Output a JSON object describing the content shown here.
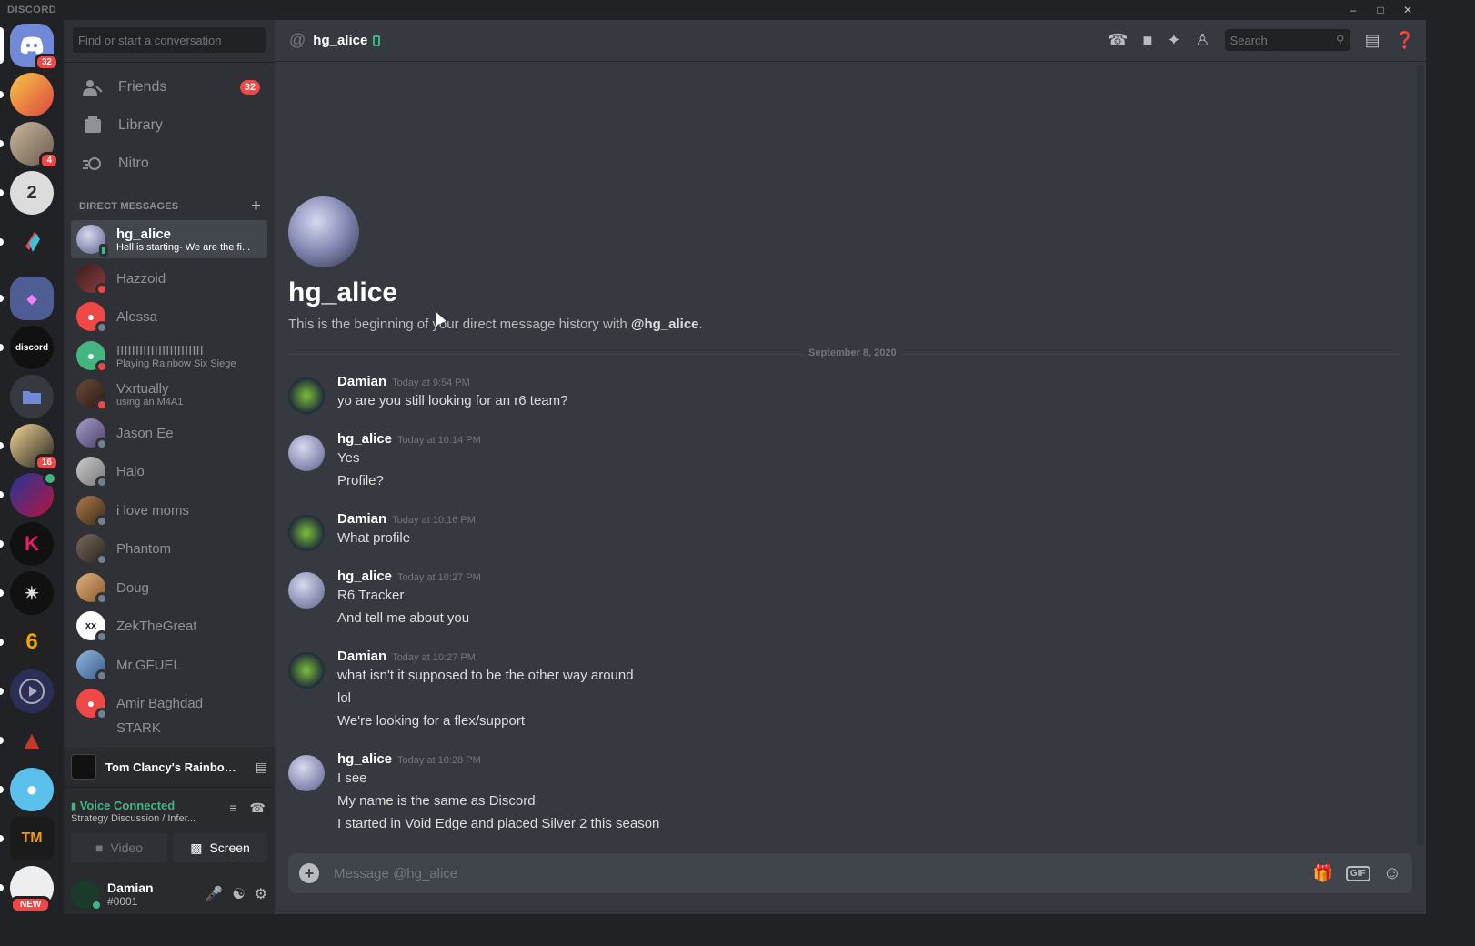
{
  "window": {
    "brand": "DISCORD",
    "controls": [
      "minimize-icon",
      "maximize-icon",
      "close-icon"
    ]
  },
  "guilds": {
    "home_badge": "32",
    "badges": {
      "g2": "4",
      "g9": "16"
    },
    "labels": {
      "g7": "discord",
      "g17": "NEW"
    }
  },
  "sidebar": {
    "search_placeholder": "Find or start a conversation",
    "nav": [
      {
        "label": "Friends",
        "badge": "32"
      },
      {
        "label": "Library"
      },
      {
        "label": "Nitro"
      }
    ],
    "dm_header": "DIRECT MESSAGES",
    "dms": [
      {
        "name": "hg_alice",
        "sub": "Hell is starting- We are the fi...",
        "status": "mobile"
      },
      {
        "name": "Hazzoid",
        "sub": "",
        "status": "dnd"
      },
      {
        "name": "Alessa",
        "sub": "",
        "status": "offline"
      },
      {
        "name": "IIIIIIIIIIIIIIIIIIIIIII",
        "sub": "Playing Rainbow Six Siege",
        "status": "dnd"
      },
      {
        "name": "Vxrtually",
        "sub": "using an M4A1",
        "status": "dnd"
      },
      {
        "name": "Jason Ee",
        "sub": "",
        "status": "offline"
      },
      {
        "name": "Halo",
        "sub": "",
        "status": "offline"
      },
      {
        "name": "i love moms",
        "sub": "",
        "status": "offline"
      },
      {
        "name": "Phantom",
        "sub": "",
        "status": "offline"
      },
      {
        "name": "Doug",
        "sub": "",
        "status": "offline"
      },
      {
        "name": "ZekTheGreat",
        "sub": "",
        "status": "offline"
      },
      {
        "name": "Mr.GFUEL",
        "sub": "",
        "status": "offline"
      },
      {
        "name": "Amir Baghdad",
        "sub": "",
        "status": "offline"
      },
      {
        "name": "STARK",
        "sub": "",
        "status": "dnd"
      }
    ],
    "game": "Tom Clancy's Rainbow ...",
    "voice": {
      "status": "Voice Connected",
      "channel": "Strategy Discussion / Infer...",
      "video_label": "Video",
      "screen_label": "Screen"
    },
    "user": {
      "name": "Damian",
      "tag": "#0001"
    }
  },
  "channel": {
    "title": "hg_alice",
    "search_placeholder": "Search",
    "intro_title": "hg_alice",
    "intro_text": "This is the beginning of your direct message history with ",
    "intro_mention": "@hg_alice",
    "intro_end": ".",
    "date_divider": "September 8, 2020"
  },
  "messages": [
    {
      "author": "Damian",
      "time": "Today at 9:54 PM",
      "lines": [
        "yo are you still looking for an r6 team?"
      ]
    },
    {
      "author": "hg_alice",
      "time": "Today at 10:14 PM",
      "lines": [
        "Yes",
        "Profile?"
      ]
    },
    {
      "author": "Damian",
      "time": "Today at 10:16 PM",
      "lines": [
        "What profile"
      ]
    },
    {
      "author": "hg_alice",
      "time": "Today at 10:27 PM",
      "lines": [
        "R6 Tracker",
        "And tell me about you"
      ]
    },
    {
      "author": "Damian",
      "time": "Today at 10:27 PM",
      "lines": [
        "what isn't it supposed to be the other way around",
        "lol",
        "We're looking for a flex/support"
      ]
    },
    {
      "author": "hg_alice",
      "time": "Today at 10:28 PM",
      "lines": [
        "I see",
        "My name is the same as Discord",
        "I started in Void Edge and placed Silver 2 this season"
      ]
    }
  ],
  "composer": {
    "placeholder": "Message @hg_alice",
    "gif_label": "GIF"
  },
  "colors": {
    "accent": "#7289da",
    "online": "#43b581",
    "dnd": "#f04747",
    "offline": "#747f8d",
    "badge": "#f04747"
  }
}
